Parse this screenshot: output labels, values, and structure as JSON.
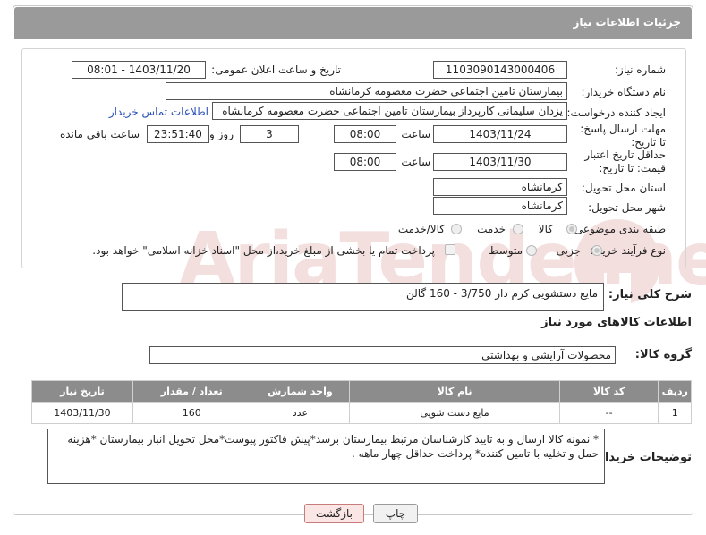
{
  "header": {
    "title": "جزئیات اطلاعات نیاز"
  },
  "form": {
    "need_number_label": "شماره نیاز:",
    "need_number": "1103090143000406",
    "announce_label": "تاریخ و ساعت اعلان عمومی:",
    "announce_value": "1403/11/20 - 08:01",
    "buyer_label": "نام دستگاه خریدار:",
    "buyer_value": "بیمارستان تامین اجتماعی حضرت معصومه کرمانشاه",
    "creator_label": "ایجاد کننده درخواست:",
    "creator_value": "یزدان  سلیمانی کارپرداز بیمارستان تامین اجتماعی حضرت معصومه کرمانشاه",
    "contact_link": "اطلاعات تماس خریدار",
    "deadline_label": "مهلت ارسال پاسخ: تا تاریخ:",
    "deadline_date": "1403/11/24",
    "time_label": "ساعت",
    "deadline_time": "08:00",
    "days_value": "3",
    "days_label": "روز و",
    "remaining_time": "23:51:40",
    "remaining_label": "ساعت باقی مانده",
    "validity_label": "حداقل تاریخ اعتبار قیمت: تا تاریخ:",
    "validity_date": "1403/11/30",
    "validity_time": "08:00",
    "province_label": "استان محل تحویل:",
    "province_value": "کرمانشاه",
    "city_label": "شهر محل تحویل:",
    "city_value": "کرمانشاه",
    "category_label": "طبقه بندی موضوعی:",
    "category_options": [
      "کالا",
      "خدمت",
      "کالا/خدمت"
    ],
    "category_selected": "کالا",
    "process_label": "نوع فرآیند خرید :",
    "process_options": [
      "جزیی",
      "متوسط"
    ],
    "payment_note": "پرداخت تمام یا بخشی از مبلغ خرید،از محل \"اسناد خزانه اسلامی\" خواهد بود."
  },
  "summary": {
    "label": "شرح کلی نیاز:",
    "value": "مایع دستشویی کرم دار 3/750 - 160 گالن"
  },
  "goods_info": {
    "title": "اطلاعات کالاهای مورد نیاز",
    "group_label": "گروه کالا:",
    "group_value": "محصولات آرایشی و بهداشتی"
  },
  "table": {
    "headers": [
      "ردیف",
      "کد کالا",
      "نام کالا",
      "واحد شمارش",
      "تعداد / مقدار",
      "تاریخ نیاز"
    ],
    "rows": [
      [
        "1",
        "--",
        "مایع دست شویی",
        "عدد",
        "160",
        "1403/11/30"
      ]
    ]
  },
  "buyer_notes": {
    "label": "توضیحات خریدار:",
    "value": "* نمونه کالا ارسال و به تایید کارشناسان مرتبط بیمارستان برسد*پیش فاکتور پیوست*محل تحویل انبار بیمارستان *هزینه حمل و تخلیه با تامین کننده* پرداخت حداقل چهار ماهه ."
  },
  "buttons": {
    "print": "چاپ",
    "back": "بازگشت"
  },
  "watermark": "AriaTender.net",
  "colors": {
    "header": "#9a9a9a",
    "table_header": "#8c8c8c",
    "link": "#2a4fb8",
    "back_button": "#fbe6e6"
  }
}
